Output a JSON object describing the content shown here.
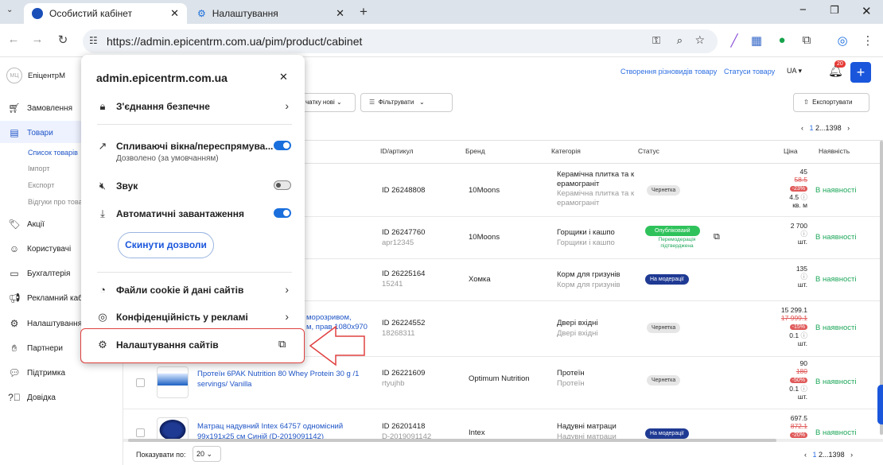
{
  "browser": {
    "tabs": [
      {
        "label": "Особистий кабінет"
      },
      {
        "label": "Налаштування"
      }
    ],
    "url": "https://admin.epicentrm.com.ua/pim/product/cabinet"
  },
  "sidebar": {
    "logo_badge": "МЦ",
    "logo_text": "ЕпіцентрМ",
    "items": [
      {
        "label": "Замовлення",
        "icon": "cart-icon"
      },
      {
        "label": "Товари",
        "icon": "products-icon"
      },
      {
        "label": "Акції",
        "icon": "promo-icon"
      },
      {
        "label": "Користувачі",
        "icon": "users-icon"
      },
      {
        "label": "Бухгалтерія",
        "icon": "accounting-icon"
      },
      {
        "label": "Рекламний кабі",
        "icon": "megaphone-icon"
      },
      {
        "label": "Налаштування",
        "icon": "gear-icon"
      },
      {
        "label": "Партнери",
        "icon": "handshake-icon"
      },
      {
        "label": "Підтримка",
        "icon": "chat-icon"
      },
      {
        "label": "Довідка",
        "icon": "help-icon"
      }
    ],
    "sub_items": [
      "Список товарів",
      "Імпорт",
      "Експорт",
      "Відгуки про това"
    ]
  },
  "header": {
    "links": [
      "Створення різновидів товару",
      "Статуси товару"
    ],
    "lang": "UA",
    "notif_count": "20"
  },
  "filters": {
    "sort_label": "чатку нові",
    "filter_label": "Фільтрувати",
    "export_label": "Експортувати"
  },
  "pagination": {
    "current": "1",
    "rest": "2...1398"
  },
  "table": {
    "headers": [
      "ID/артикул",
      "Бренд",
      "Категорія",
      "Статус",
      "Ціна",
      "Наявність"
    ],
    "rows": [
      {
        "id": "ID 26248808",
        "article": "",
        "brand": "10Moons",
        "category": "Керамічна плитка та к ерамограніт",
        "category_sub": "Керамічна плитка та к ерамограніт",
        "status": "Чернетка",
        "price": "45",
        "old_price": "58.5",
        "discount": "-23%",
        "unit_price": "4.5",
        "unit": "кв. м",
        "availability": "В наявності"
      },
      {
        "id": "ID 26247760",
        "article": "apr12345",
        "brand": "10Moons",
        "category": "Горщики і кашпо",
        "category_sub": "Горщики і кашпо",
        "status": "Опубліковаий",
        "status_note": "Перемодерація підтверджена",
        "price": "2 700",
        "unit": "шт.",
        "availability": "В наявності"
      },
      {
        "id": "ID 26225164",
        "article": "15241",
        "brand": "Хомка",
        "category": "Корм для гризунів",
        "category_sub": "Корм для гризунів",
        "status": "На модерації",
        "price": "135",
        "unit": "шт.",
        "availability": "В наявності"
      },
      {
        "id": "ID 26224552",
        "article": "18268311",
        "brand": "",
        "category": "Двері вхідні",
        "category_sub": "Двері вхідні",
        "status": "Чернетка",
        "name": "морозривом,",
        "name2": "м, прав 1080x970",
        "price": "15 299.1",
        "old_price": "17 999.1",
        "discount": "-15%",
        "unit_price": "0.1",
        "unit": "шт.",
        "availability": "В наявності"
      },
      {
        "id": "ID 26221609",
        "article": "rtyujhb",
        "brand": "Optimum Nutrition",
        "category": "Протеїн",
        "category_sub": "Протеїн",
        "status": "Чернетка",
        "name": "Протеїн 6PAK Nutrition 80 Whey Protein 30 g /1",
        "name2": "servings/ Vanilla",
        "price": "90",
        "old_price": "180",
        "discount": "-50%",
        "unit_price": "0.1",
        "unit": "шт.",
        "availability": "В наявності"
      },
      {
        "id": "ID 26201418",
        "article": "D-2019091142",
        "brand": "Intex",
        "category": "Надувні матраци",
        "category_sub": "Надувні матраци",
        "status": "На модерації",
        "name": "Матрац надувний Intex 64757 одномісний",
        "name2": "99x191x25 см Синій (D-2019091142)",
        "price": "697.5",
        "old_price": "872.1",
        "discount": "-20%",
        "availability": "В наявності"
      }
    ]
  },
  "footer": {
    "per_page_label": "Показувати по:",
    "per_page_value": "20"
  },
  "popup": {
    "domain": "admin.epicentrm.com.ua",
    "secure": "З'єднання безпечне",
    "popups_title": "Спливаючі вікна/переспрямува...",
    "popups_sub": "Дозволено (за умовчанням)",
    "sound": "Звук",
    "downloads": "Автоматичні завантаження",
    "reset": "Скинути дозволи",
    "cookies": "Файли cookie й дані сайтів",
    "ads": "Конфіденційність у рекламі",
    "site_settings": "Налаштування сайтів"
  },
  "colors": {
    "accent": "#1a6fdc",
    "highlight": "#e04040",
    "green": "#1ea75a"
  }
}
